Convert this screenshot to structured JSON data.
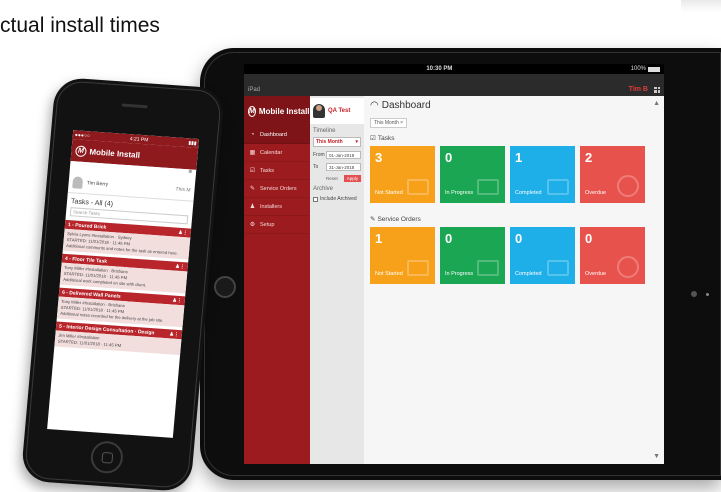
{
  "headline": "ctual install times",
  "tablet": {
    "status": {
      "device": "iPad",
      "time": "10:30 PM",
      "battery": "100%"
    },
    "top_user": "Tim B",
    "brand": "Mobile Install",
    "nav": [
      {
        "label": "Dashboard",
        "icon": "dashboard-icon"
      },
      {
        "label": "Calendar",
        "icon": "calendar-icon"
      },
      {
        "label": "Tasks",
        "icon": "tasks-icon"
      },
      {
        "label": "Service Orders",
        "icon": "wrench-icon"
      },
      {
        "label": "Installers",
        "icon": "person-icon"
      },
      {
        "label": "Setup",
        "icon": "gear-icon"
      }
    ],
    "user_title": "QA Test",
    "timeline": {
      "title": "Timeline",
      "select": "This Month",
      "from_label": "From",
      "from_value": "01-Jan-2018",
      "to_label": "To",
      "to_value": "31-Jan-2018",
      "reset": "Reset",
      "apply": "Apply"
    },
    "archive": {
      "title": "Archive",
      "checkbox": "Include Archived"
    },
    "dashboard": {
      "chip": "This Month",
      "title": "Dashboard",
      "tasks_title": "Tasks",
      "orders_title": "Service Orders"
    },
    "task_tiles": [
      {
        "num": "3",
        "label": "Not Started",
        "color": "#f7a11a"
      },
      {
        "num": "0",
        "label": "In Progress",
        "color": "#1aa652"
      },
      {
        "num": "1",
        "label": "Completed",
        "color": "#1eaee8"
      },
      {
        "num": "2",
        "label": "Overdue",
        "color": "#e8524c"
      }
    ],
    "order_tiles": [
      {
        "num": "1",
        "label": "Not Started",
        "color": "#f7a11a"
      },
      {
        "num": "0",
        "label": "In Progress",
        "color": "#1aa652"
      },
      {
        "num": "0",
        "label": "Completed",
        "color": "#1eaee8"
      },
      {
        "num": "0",
        "label": "Overdue",
        "color": "#e8524c"
      }
    ]
  },
  "phone": {
    "status_left": "●●●○○ ",
    "status_time": "4:21 PM",
    "status_right": "▮▮▮",
    "brand": "Mobile Install",
    "menu": "≡",
    "user": "Tim Berry",
    "month": "This M",
    "tasks_title": "Tasks - All (4)",
    "search_placeholder": "Search Tasks",
    "tasks": [
      {
        "title": "1 - Poured Brick",
        "body": "Sylvia Lyons  #Installation · Sydney\nSTARTED: 11/01/2018 · 11:45 PM\nAdditional comments and notes for the task as entered here."
      },
      {
        "title": "4 - Floor Tile Task",
        "body": "Tony Miller  #Installation · Brisbane\nSTARTED: 11/01/2018 · 11:45 PM\nAdditional work completed on site with client."
      },
      {
        "title": "6 - Delivered Wall Panels",
        "body": "Tony Miller  #Installation · Brisbane\nSTARTED: 11/01/2018 · 11:45 PM\nAdditional notes recorded for the delivery at the job site."
      },
      {
        "title": "5 - Interior Design Consultation · Design",
        "body": "Jim Miller  #Installation\nSTARTED: 11/01/2018 · 11:45 PM"
      }
    ]
  }
}
